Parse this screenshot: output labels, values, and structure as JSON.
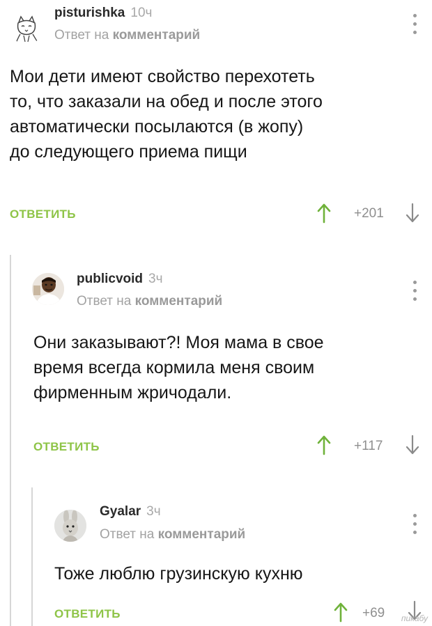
{
  "comments": [
    {
      "author": "pisturishka",
      "time": "10ч",
      "reply_prefix": "Ответ на",
      "reply_target": "комментарий",
      "text": "Мои дети имеют свойство перехотеть\nто, что заказали на обед и после этого\nавтоматически посылаются (в жопу)\nдо следующего приема пищи",
      "reply_label": "ОТВЕТИТЬ",
      "score": "+201",
      "avatar_icon": "cat-drawing-icon"
    },
    {
      "author": "publicvoid",
      "time": "3ч",
      "reply_prefix": "Ответ на",
      "reply_target": "комментарий",
      "text": "Они заказывают?! Моя мама в свое\nвремя всегда кормила меня своим\nфирменным жричодали.",
      "reply_label": "ОТВЕТИТЬ",
      "score": "+117",
      "avatar_icon": "person-photo-icon"
    },
    {
      "author": "Gyalar",
      "time": "3ч",
      "reply_prefix": "Ответ на",
      "reply_target": "комментарий",
      "text": "Тоже люблю грузинскую кухню",
      "reply_label": "ОТВЕТИТЬ",
      "score": "+69",
      "avatar_icon": "rabbit-photo-icon"
    }
  ],
  "watermark": "пикабу",
  "colors": {
    "accent_green": "#8ec447",
    "thread_line": "#d6d6d6",
    "muted_text": "#a2a2a2"
  }
}
